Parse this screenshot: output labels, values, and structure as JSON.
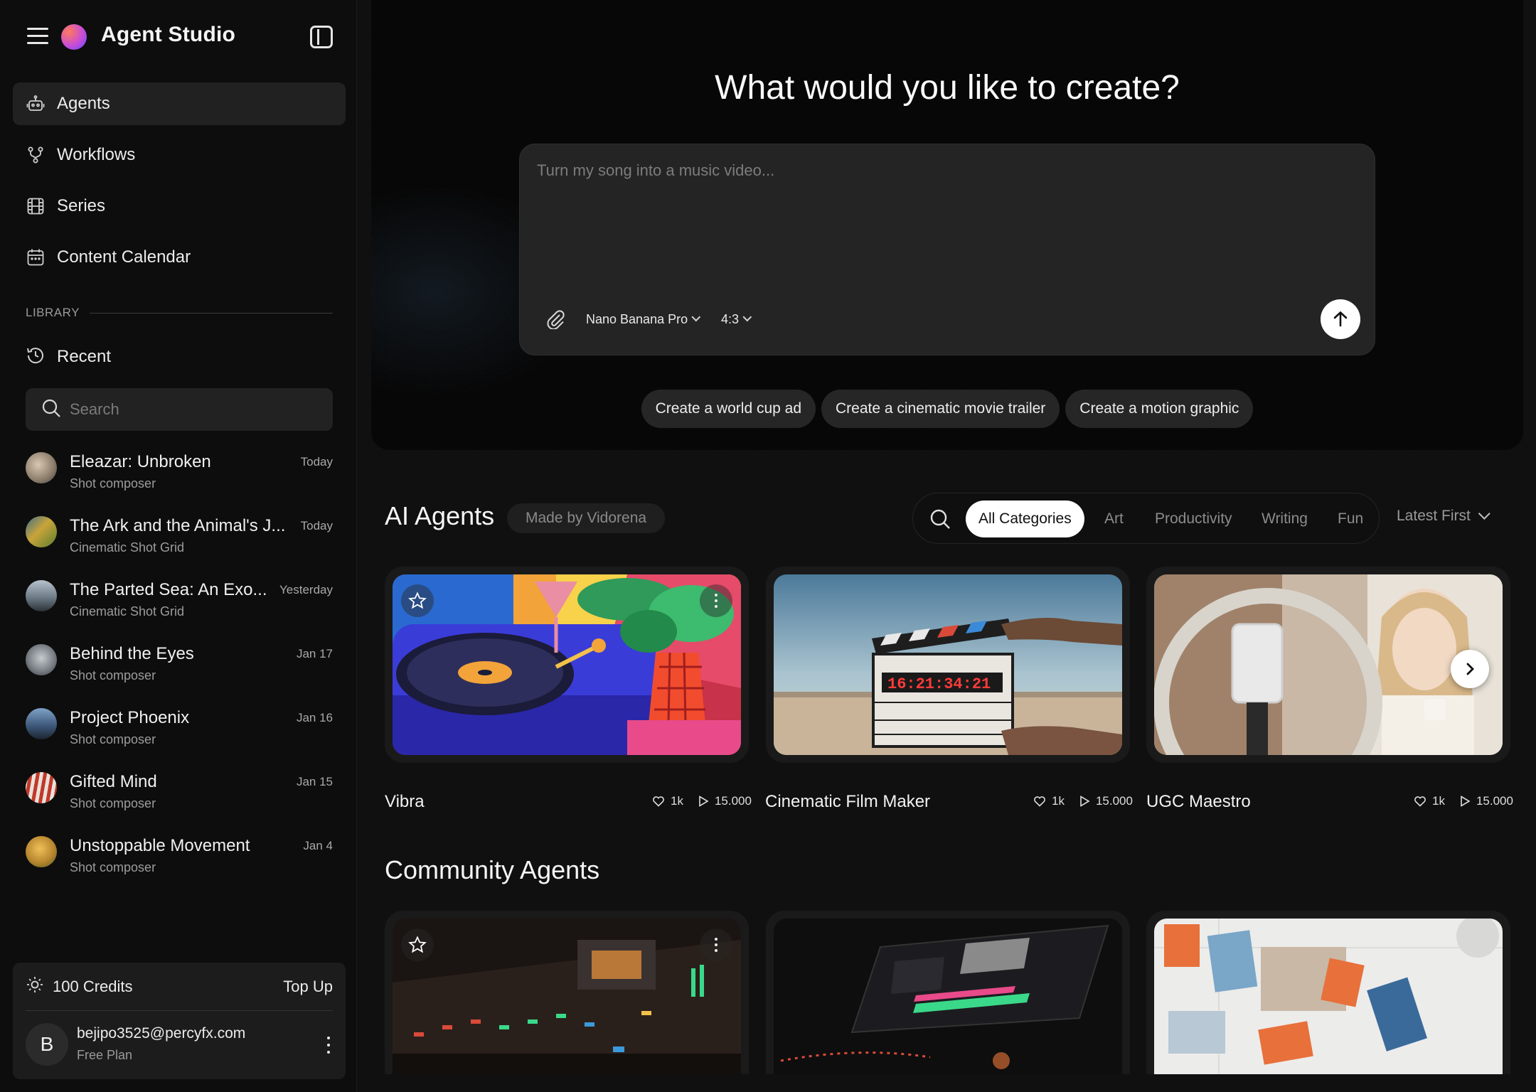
{
  "app": {
    "title": "Agent Studio"
  },
  "nav": [
    {
      "label": "Agents",
      "icon": "robot-icon",
      "active": true
    },
    {
      "label": "Workflows",
      "icon": "workflow-icon",
      "active": false
    },
    {
      "label": "Series",
      "icon": "film-icon",
      "active": false
    },
    {
      "label": "Content Calendar",
      "icon": "calendar-icon",
      "active": false
    }
  ],
  "library": {
    "heading": "LIBRARY",
    "recent_label": "Recent",
    "search_placeholder": "Search",
    "items": [
      {
        "title": "Eleazar: Unbroken",
        "subtitle": "Shot composer",
        "date": "Today",
        "avatar_color": "#8a7b6a"
      },
      {
        "title": "The Ark and the Animal's J...",
        "subtitle": "Cinematic Shot Grid",
        "date": "Today",
        "avatar_color": "#7c8a2e"
      },
      {
        "title": "The Parted Sea: An Exo...",
        "subtitle": "Cinematic Shot Grid",
        "date": "Yesterday",
        "avatar_color": "#5d6a78"
      },
      {
        "title": "Behind the Eyes",
        "subtitle": "Shot composer",
        "date": "Jan 17",
        "avatar_color": "#6f7478"
      },
      {
        "title": "Project Phoenix",
        "subtitle": "Shot composer",
        "date": "Jan 16",
        "avatar_color": "#3f5a7c"
      },
      {
        "title": "Gifted Mind",
        "subtitle": "Shot composer",
        "date": "Jan 15",
        "avatar_color": "#b84a3c"
      },
      {
        "title": "Unstoppable Movement",
        "subtitle": "Shot composer",
        "date": "Jan 4",
        "avatar_color": "#b8862e"
      }
    ]
  },
  "account": {
    "credits": "100 Credits",
    "topup": "Top Up",
    "avatar_letter": "B",
    "email": "bejipo3525@percyfx.com",
    "plan": "Free Plan"
  },
  "hero": {
    "title": "What would you like to create?",
    "prompt_placeholder": "Turn my song into a music video...",
    "model": "Nano Banana Pro",
    "ratio": "4:3",
    "suggestions": [
      "Create a world cup ad",
      "Create a cinematic movie trailer",
      "Create a motion graphic"
    ]
  },
  "ai_agents": {
    "title": "AI Agents",
    "tag": "Made by Vidorena",
    "filters": [
      "All Categories",
      "Art",
      "Productivity",
      "Writing",
      "Fun"
    ],
    "active_filter": "All Categories",
    "sort": "Latest First",
    "cards": [
      {
        "name": "Vibra",
        "likes": "1k",
        "plays": "15.000"
      },
      {
        "name": "Cinematic Film Maker",
        "likes": "1k",
        "plays": "15.000"
      },
      {
        "name": "UGC Maestro",
        "likes": "1k",
        "plays": "15.000"
      }
    ]
  },
  "community_agents": {
    "title": "Community Agents"
  },
  "colors": {
    "accent": "#ffffff",
    "bg": "#101010",
    "sidebar": "#0d0d0d",
    "panel": "#242424"
  }
}
